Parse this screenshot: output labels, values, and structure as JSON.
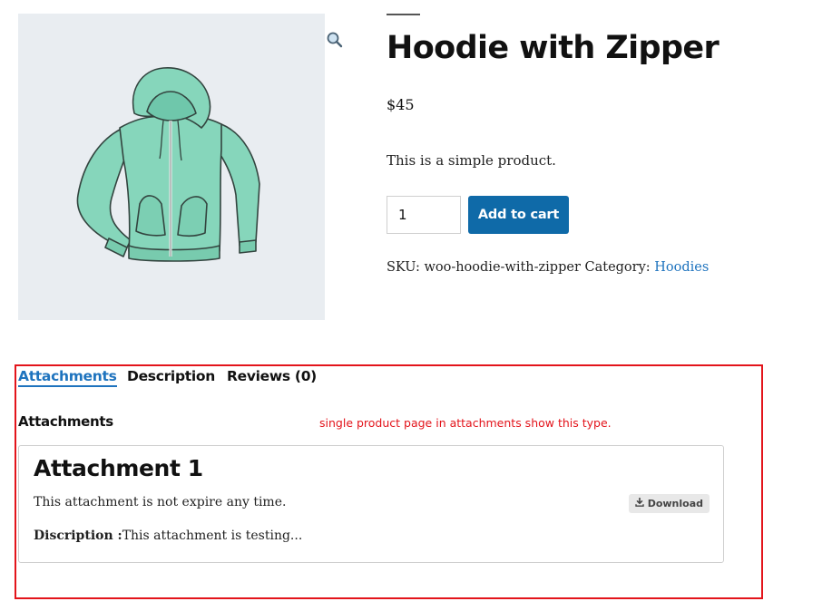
{
  "product": {
    "image_alt": "Hoodie with Zipper",
    "title": "Hoodie with Zipper",
    "price": "$45",
    "short_description": "This is a simple product.",
    "quantity": "1",
    "add_to_cart_label": "Add to cart",
    "sku_label": "SKU:",
    "sku": "woo-hoodie-with-zipper",
    "category_label": "Category:",
    "category": "Hoodies"
  },
  "tabs": [
    {
      "label": "Attachments",
      "active": true
    },
    {
      "label": "Description",
      "active": false
    },
    {
      "label": "Reviews (0)",
      "active": false
    }
  ],
  "attachments": {
    "heading": "Attachments",
    "annotation": "single product page in attachments show this type.",
    "items": [
      {
        "title": "Attachment 1",
        "expiry_text": "This attachment is not expire any time.",
        "description_label": "Discription :",
        "description": "This attachment is testing...",
        "download_label": "Download"
      }
    ]
  },
  "icons": {
    "zoom": "magnifier-icon",
    "download": "download-icon"
  },
  "colors": {
    "accent": "#1e73be",
    "button": "#0f6aa8",
    "annotation": "#e3141b",
    "hoodie": "#7fd4b8"
  }
}
